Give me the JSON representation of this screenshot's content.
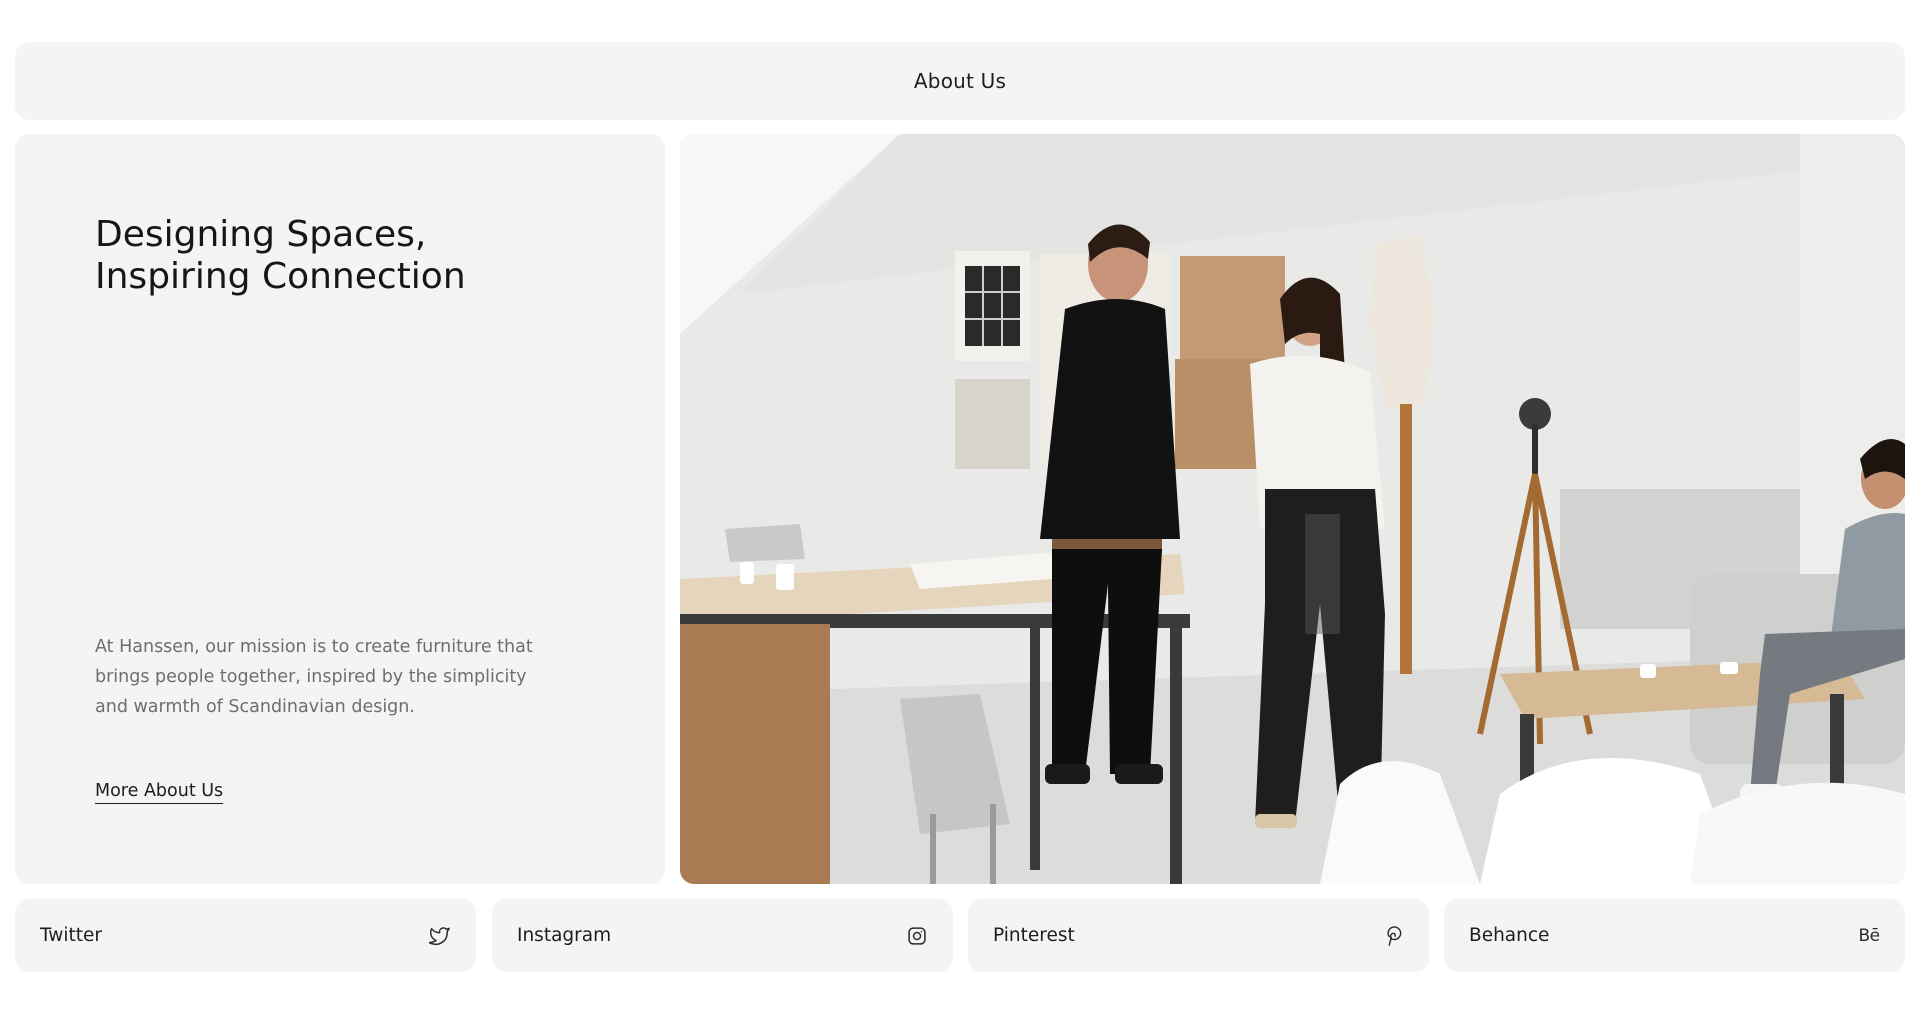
{
  "header": {
    "title": "About Us"
  },
  "intro": {
    "headline_line1": "Designing Spaces,",
    "headline_line2": "Inspiring Connection",
    "mission": "At Hanssen, our mission is to create furniture that brings people together, inspired by the simplicity and warmth of Scandinavian design.",
    "more_link": "More About Us"
  },
  "social": {
    "items": [
      {
        "label": "Twitter",
        "icon": "twitter-icon"
      },
      {
        "label": "Instagram",
        "icon": "instagram-icon"
      },
      {
        "label": "Pinterest",
        "icon": "pinterest-icon"
      },
      {
        "label": "Behance",
        "icon": "behance-icon",
        "icon_text": "Bē"
      }
    ]
  },
  "colors": {
    "background": "#ffffff",
    "card": "#f4f4f4",
    "text_primary": "#161616",
    "text_muted": "#6e6e6e"
  }
}
